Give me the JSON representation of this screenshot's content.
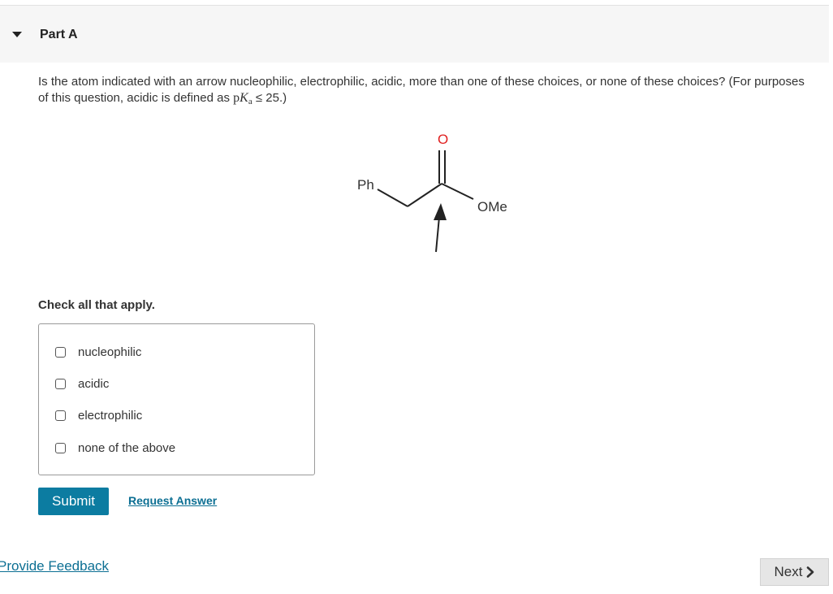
{
  "part": {
    "title": "Part A"
  },
  "question": {
    "text": "Is the atom indicated with an arrow nucleophilic, electrophilic, acidic, more than one of these choices, or none of these choices? (For purposes of this question, acidic is defined as",
    "pka_p": "p",
    "pka_k": "K",
    "pka_sub": "a",
    "suffix": "≤ 25.)"
  },
  "molecule": {
    "label_ph": "Ph",
    "label_o": "O",
    "label_ome": "OMe"
  },
  "instructions": "Check all that apply.",
  "options": [
    {
      "label": "nucleophilic",
      "checked": false
    },
    {
      "label": "acidic",
      "checked": false
    },
    {
      "label": "electrophilic",
      "checked": false
    },
    {
      "label": "none of the above",
      "checked": false
    }
  ],
  "actions": {
    "submit_label": "Submit",
    "request_answer_label": "Request Answer"
  },
  "footer": {
    "feedback_label": "Provide Feedback",
    "next_label": "Next"
  },
  "colors": {
    "submit_bg": "#0c7ca1",
    "link": "#0c6f93",
    "oxygen": "#e02020"
  }
}
